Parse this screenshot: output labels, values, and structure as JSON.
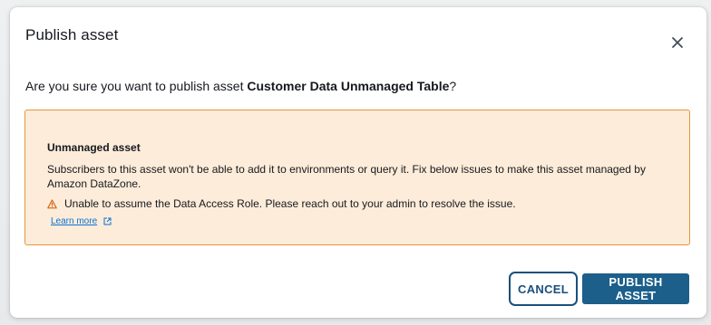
{
  "modal": {
    "title": "Publish asset",
    "confirm_prefix": "Are you sure you want to publish asset ",
    "asset_name": "Customer Data Unmanaged Table",
    "confirm_suffix": "?"
  },
  "alert": {
    "title": "Unmanaged asset",
    "body": "Subscribers to this asset won't be able to add it to environments or query it. Fix below issues to make this asset managed by Amazon DataZone.",
    "issue": "Unable to assume the Data Access Role. Please reach out to your admin to resolve the issue.",
    "learn_more": "Learn more",
    "issue_icon": "warning-icon",
    "link_icon": "external-link-icon"
  },
  "buttons": {
    "cancel": "CANCEL",
    "publish": "PUBLISH ASSET"
  },
  "colors": {
    "alert_bg": "#fdecd9",
    "alert_border": "#e6953c",
    "primary": "#1b5f8a",
    "link": "#0972d3",
    "warning": "#d86613"
  }
}
